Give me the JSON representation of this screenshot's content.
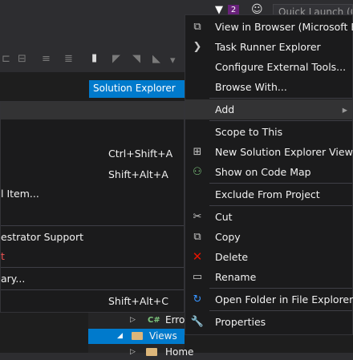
{
  "title_bar": {
    "notification_count": "2",
    "quick_launch_placeholder": "Quick Launch (C"
  },
  "solution_explorer": {
    "tab_label": "Solution Explorer",
    "tree": [
      {
        "label": "Erro"
      },
      {
        "label": "Views"
      },
      {
        "label": "Home"
      }
    ]
  },
  "left_menu": {
    "items": [
      {
        "label": "",
        "shortcut": ""
      },
      {
        "label": "",
        "shortcut": "Ctrl+Shift+A"
      },
      {
        "label": "",
        "shortcut": "Shift+Alt+A"
      },
      {
        "label": "l Item...",
        "shortcut": ""
      },
      {
        "label": "estrator Support",
        "shortcut": ""
      },
      {
        "label": "t",
        "shortcut": ""
      },
      {
        "label": "ary...",
        "shortcut": ""
      },
      {
        "label": "",
        "shortcut": "Shift+Alt+C"
      }
    ]
  },
  "right_menu": {
    "items": [
      {
        "label": "View in Browser (Microsoft Ed",
        "icon": "browser-icon"
      },
      {
        "label": "Task Runner Explorer",
        "icon": "chevron-right-icon"
      },
      {
        "label": "Configure External Tools...",
        "icon": ""
      },
      {
        "label": "Browse With...",
        "icon": ""
      },
      {
        "label": "Add",
        "icon": ""
      },
      {
        "label": "Scope to This",
        "icon": ""
      },
      {
        "label": "New Solution Explorer View",
        "icon": "new-view-icon"
      },
      {
        "label": "Show on Code Map",
        "icon": "code-map-icon"
      },
      {
        "label": "Exclude From Project",
        "icon": ""
      },
      {
        "label": "Cut",
        "icon": "scissors-icon"
      },
      {
        "label": "Copy",
        "icon": "copy-icon"
      },
      {
        "label": "Delete",
        "icon": "delete-x-icon"
      },
      {
        "label": "Rename",
        "icon": "rename-icon"
      },
      {
        "label": "Open Folder in File Explorer",
        "icon": "refresh-arrow-icon"
      },
      {
        "label": "Properties",
        "icon": "wrench-icon"
      }
    ]
  },
  "colors": {
    "accent": "#007acc",
    "menu_bg": "#1b1b1c",
    "delete_red": "#e51400",
    "highlight_text": "#f05454"
  }
}
